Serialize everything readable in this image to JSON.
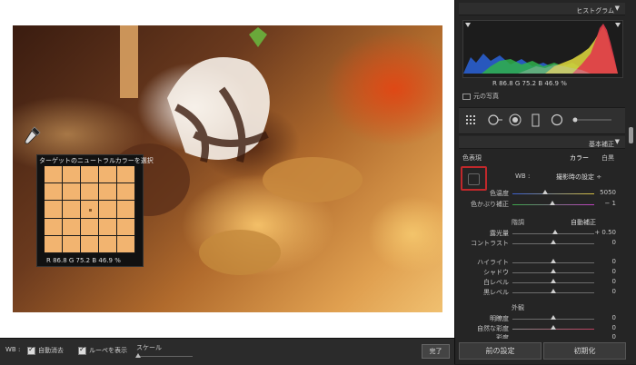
{
  "loupe": {
    "title": "ターゲットのニュートラルカラーを選択",
    "readout": "R 86.8  G 75.2  B 46.9 %"
  },
  "toolbar": {
    "wb_label": "WB :",
    "auto_dismiss": "自動消去",
    "show_loupe": "ルーペを表示",
    "scale_label": "スケール",
    "done": "完了"
  },
  "panel": {
    "histogram_title": "ヒストグラム",
    "histogram_readout": "R  86.8  G  75.2  B  46.9 %",
    "original_photo": "元の写真",
    "basic_title": "基本補正",
    "treatment_label": "色表現",
    "color_tab": "カラー",
    "bw_tab": "白黒",
    "wb_label": "WB :",
    "wb_value": "撮影時の設定 ÷",
    "temp_label": "色温度",
    "temp_value": "5050",
    "tint_label": "色かぶり補正",
    "tint_value": "− 1",
    "tone_head": "階調",
    "auto_tone": "自動補正",
    "exposure_label": "露光量",
    "exposure_value": "+ 0.50",
    "contrast_label": "コントラスト",
    "contrast_value": "0",
    "highlights_label": "ハイライト",
    "highlights_value": "0",
    "shadows_label": "シャドウ",
    "shadows_value": "0",
    "whites_label": "白レベル",
    "whites_value": "0",
    "blacks_label": "黒レベル",
    "blacks_value": "0",
    "presence_head": "外観",
    "clarity_label": "明瞭度",
    "clarity_value": "0",
    "vibrance_label": "自然な彩度",
    "vibrance_value": "0",
    "saturation_label": "彩度",
    "saturation_value": "0",
    "prev_button": "前の設定",
    "reset_button": "初期化"
  },
  "sliders": {
    "temp": 0.4,
    "tint": 0.49,
    "exposure": 0.52,
    "contrast": 0.5,
    "highlights": 0.5,
    "shadows": 0.5,
    "whites": 0.5,
    "blacks": 0.5,
    "clarity": 0.5,
    "vibrance": 0.5,
    "saturation": 0.5
  },
  "icons": {
    "dropdown": "triangle-down-icon",
    "eyedropper": "eyedropper-icon",
    "crop": "crop-overlay-icon",
    "spot": "spot-removal-icon",
    "redeye": "red-eye-icon",
    "gradient": "graduated-filter-icon",
    "radial": "radial-filter-icon",
    "brush": "adjustment-brush-icon"
  }
}
